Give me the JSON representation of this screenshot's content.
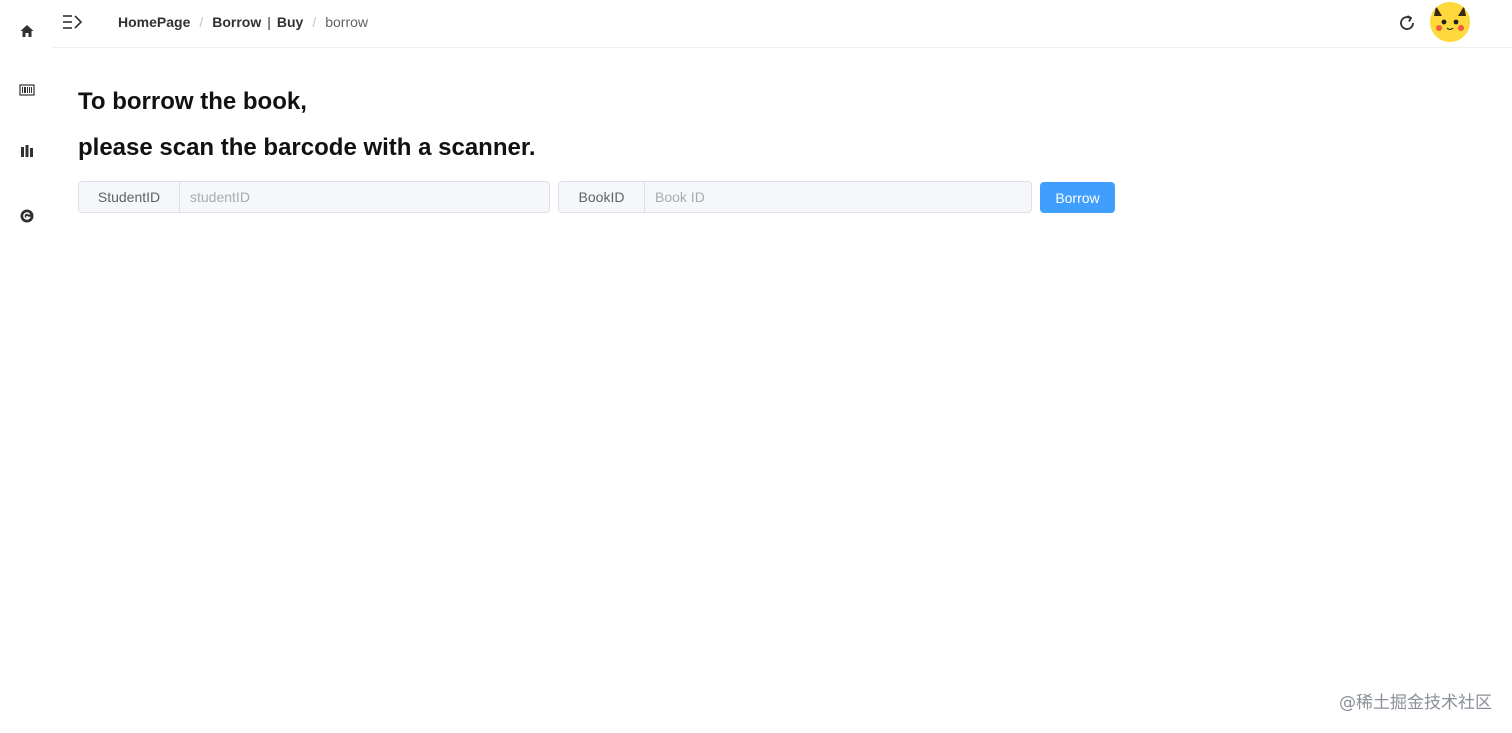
{
  "sidebar": {
    "items": [
      {
        "icon": "home-icon"
      },
      {
        "icon": "barcode-icon"
      },
      {
        "icon": "library-icon"
      },
      {
        "icon": "github-icon"
      }
    ]
  },
  "header": {
    "collapse_icon": "menu-unfold-icon",
    "breadcrumb": {
      "home": "HomePage",
      "sep": "/",
      "section_part1": "Borrow",
      "section_divider": "|",
      "section_part2": "Buy",
      "current": "borrow"
    },
    "refresh_icon": "refresh-icon",
    "avatar": "pikachu-avatar"
  },
  "main": {
    "heading_line1": "To borrow the book,",
    "heading_line2": "please scan the barcode with a scanner.",
    "student_field": {
      "label": "StudentID",
      "placeholder": "studentID",
      "value": ""
    },
    "book_field": {
      "label": "BookID",
      "placeholder": "Book ID",
      "value": ""
    },
    "borrow_button": "Borrow"
  },
  "watermark": "@稀土掘金技术社区",
  "colors": {
    "primary": "#409eff",
    "input_bg": "#f5f7fa",
    "border": "#dcdfe6"
  }
}
